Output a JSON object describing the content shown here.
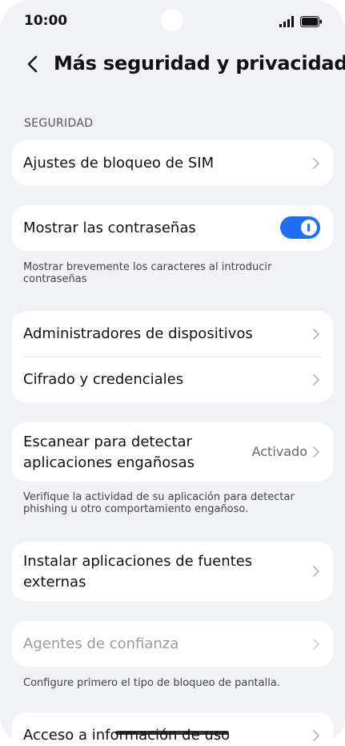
{
  "status": {
    "time": "10:00"
  },
  "header": {
    "title": "Más seguridad y privacidad"
  },
  "section": {
    "label": "SEGURIDAD"
  },
  "items": {
    "sim_lock": {
      "label": "Ajustes de bloqueo de SIM"
    },
    "show_passwords": {
      "label": "Mostrar las contraseñas",
      "enabled": true,
      "note": "Mostrar brevemente los caracteres al introducir contraseñas"
    },
    "device_admins": {
      "label": "Administradores de dispositivos"
    },
    "encryption": {
      "label": "Cifrado y credenciales"
    },
    "scan_apps": {
      "label_line1": "Escanear para detectar",
      "label_line2": "aplicaciones engañosas",
      "value": "Activado",
      "note": "Verifique la actividad de su aplicación para detectar phishing u otro comportamiento engañoso."
    },
    "external_sources": {
      "label_line1": "Instalar aplicaciones de fuentes",
      "label_line2": "externas"
    },
    "trust_agents": {
      "label": "Agentes de confianza",
      "note": "Configure primero el tipo de bloqueo de pantalla."
    },
    "usage_access": {
      "label": "Acceso a información de uso"
    }
  },
  "colors": {
    "accent": "#1e6ff2",
    "background": "#f1f2f6",
    "card": "#ffffff"
  }
}
